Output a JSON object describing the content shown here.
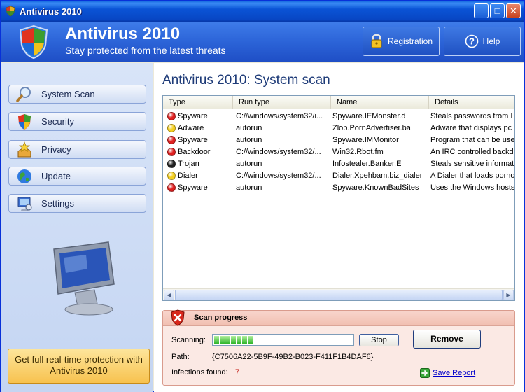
{
  "window": {
    "title": "Antivirus 2010",
    "controls": [
      "minimize",
      "maximize",
      "close"
    ]
  },
  "header": {
    "app_name": "Antivirus 2010",
    "tagline": "Stay protected from the latest threats",
    "registration_label": "Registration",
    "help_label": "Help"
  },
  "sidebar": {
    "items": [
      {
        "label": "System Scan",
        "icon": "magnifier-icon"
      },
      {
        "label": "Security",
        "icon": "shield-icon"
      },
      {
        "label": "Privacy",
        "icon": "privacy-icon"
      },
      {
        "label": "Update",
        "icon": "globe-icon"
      },
      {
        "label": "Settings",
        "icon": "settings-icon"
      }
    ],
    "promo": "Get full real-time protection with Antivirus 2010"
  },
  "main": {
    "title": "Antivirus 2010: System scan",
    "columns": [
      "Type",
      "Run type",
      "Name",
      "Details"
    ],
    "rows": [
      {
        "type": "Spyware",
        "level": "red",
        "run_type": "C://windows/system32/i...",
        "name": "Spyware.IEMonster.d",
        "details": "Steals passwords from I"
      },
      {
        "type": "Adware",
        "level": "yellow",
        "run_type": "autorun",
        "name": "Zlob.PornAdvertiser.ba",
        "details": "Adware that displays pc"
      },
      {
        "type": "Spyware",
        "level": "red",
        "run_type": "autorun",
        "name": "Spyware.IMMonitor",
        "details": "Program that can be use"
      },
      {
        "type": "Backdoor",
        "level": "red",
        "run_type": "C://windows/system32/...",
        "name": "Win32.Rbot.fm",
        "details": "An IRC controlled backd"
      },
      {
        "type": "Trojan",
        "level": "black",
        "run_type": "autorun",
        "name": "Infostealer.Banker.E",
        "details": "Steals sensitive informat"
      },
      {
        "type": "Dialer",
        "level": "yellow",
        "run_type": "C://windows/system32/...",
        "name": "Dialer.Xpehbam.biz_dialer",
        "details": "A Dialer that loads porno"
      },
      {
        "type": "Spyware",
        "level": "red",
        "run_type": "autorun",
        "name": "Spyware.KnownBadSites",
        "details": "Uses the Windows hosts"
      }
    ]
  },
  "scan": {
    "title": "Scan progress",
    "scanning_label": "Scanning:",
    "progress": 0.3,
    "stop_label": "Stop",
    "remove_label": "Remove",
    "path_label": "Path:",
    "path_value": "{C7506A22-5B9F-49B2-B023-F411F1B4DAF6}",
    "infections_label": "Infections found:",
    "infections_count": "7",
    "save_report_label": "Save Report"
  },
  "colors": {
    "title_bar": "#0a54d6",
    "header": "#2c64d8",
    "sidebar": "#c4d5f2",
    "status_red": "#e02020",
    "status_yellow": "#f5d020",
    "status_black": "#222222",
    "progress_green": "#2fb52a",
    "infection_count": "#c0160f"
  }
}
